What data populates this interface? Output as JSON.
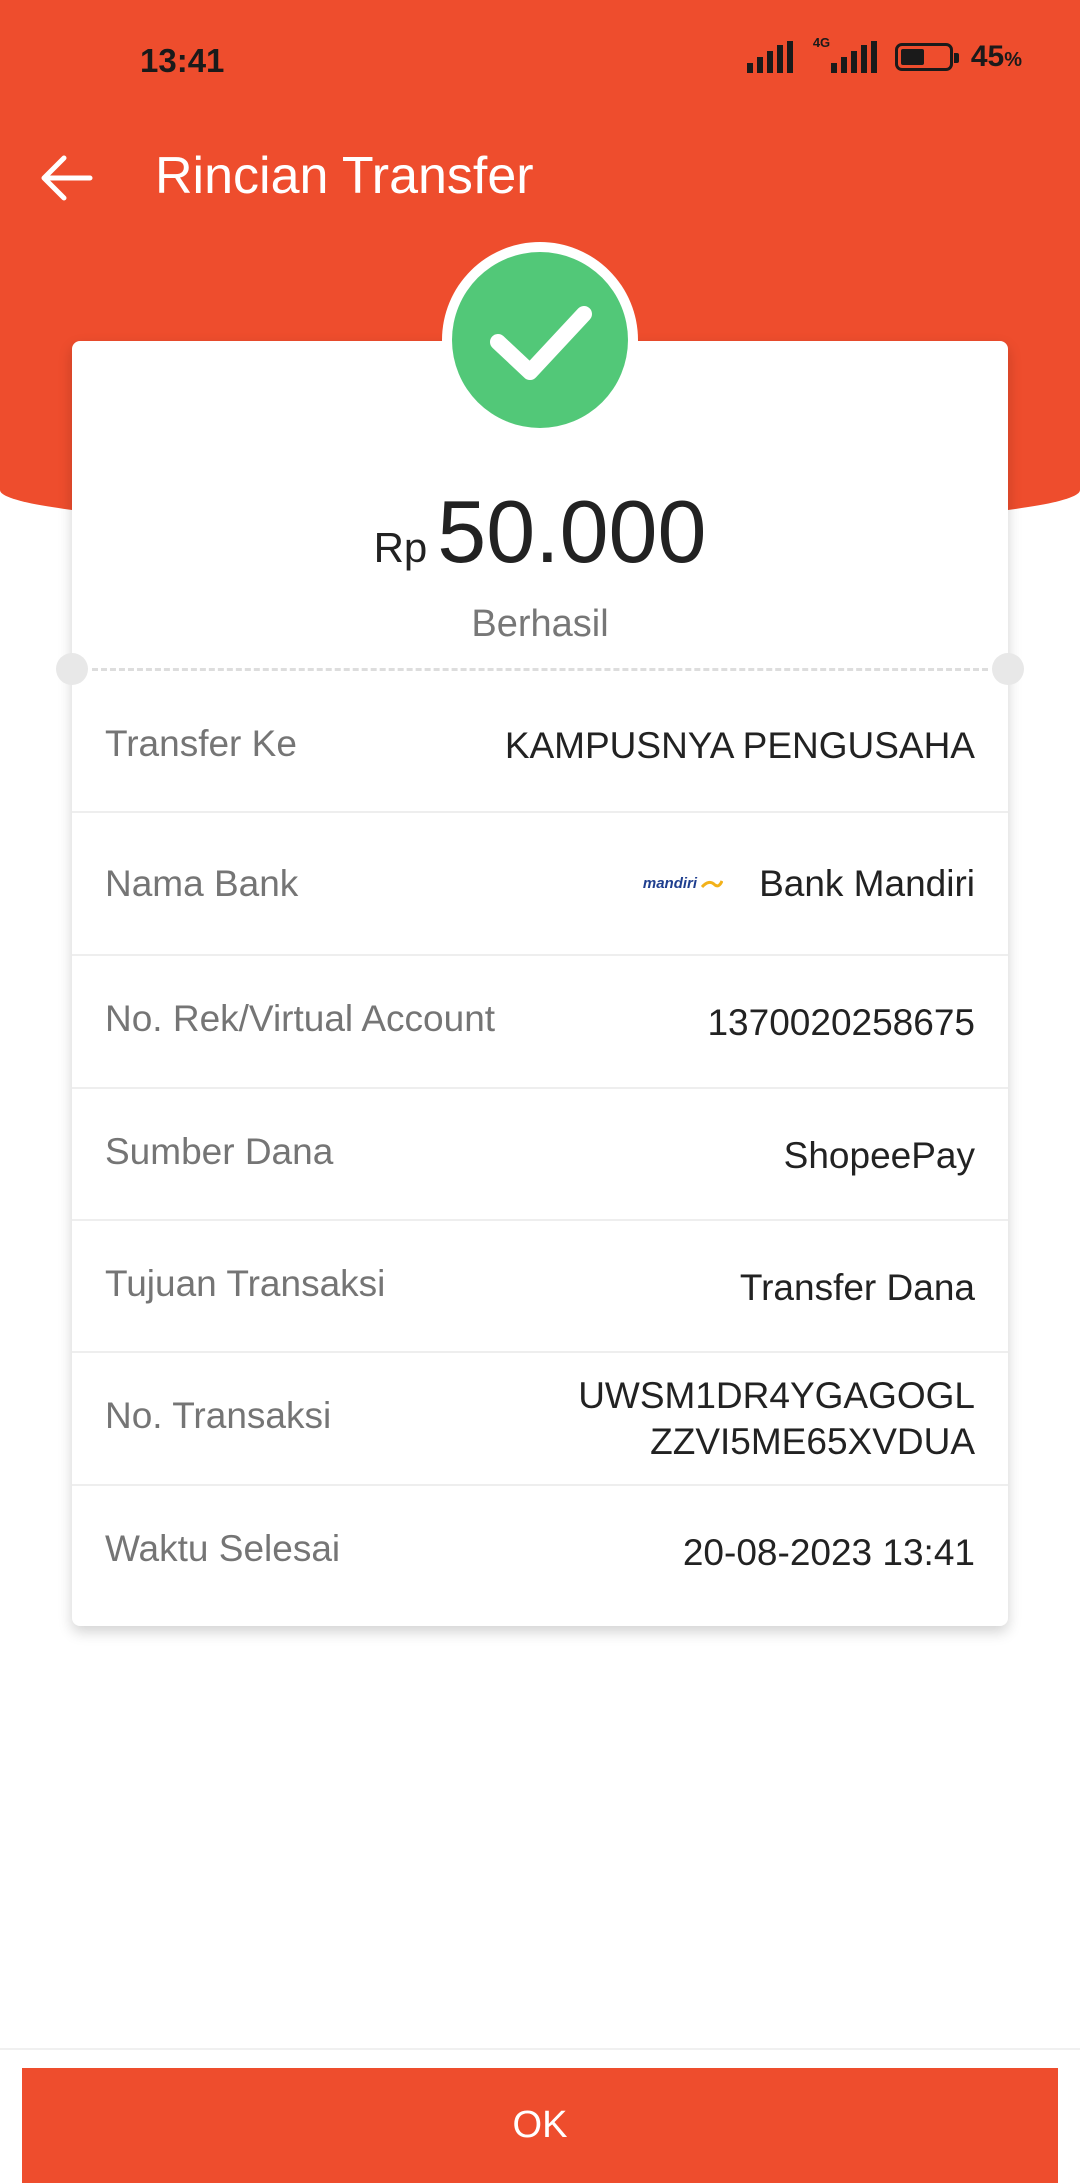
{
  "status_bar": {
    "time": "13:41",
    "network": "4G",
    "battery_percent": "45",
    "battery_unit": "%",
    "battery_level": 0.45
  },
  "header": {
    "title": "Rincian Transfer"
  },
  "receipt": {
    "currency": "Rp",
    "amount": "50.000",
    "status": "Berhasil",
    "status_color": "#52c878",
    "rows": [
      {
        "label": "Transfer Ke",
        "value": "KAMPUSNYA PENGUSAHA"
      },
      {
        "label": "Nama Bank",
        "value": "Bank Mandiri",
        "logo_text": "mandiri"
      },
      {
        "label": "No. Rek/Virtual Account",
        "value": "1370020258675"
      },
      {
        "label": "Sumber Dana",
        "value": "ShopeePay"
      },
      {
        "label": "Tujuan Transaksi",
        "value": "Transfer Dana"
      },
      {
        "label": "No. Transaksi",
        "value_line1": "UWSM1DR4YGAGOGL",
        "value_line2": "ZZVI5ME65XVDUA"
      },
      {
        "label": "Waktu Selesai",
        "value": "20-08-2023 13:41"
      }
    ]
  },
  "footer": {
    "ok_label": "OK"
  },
  "colors": {
    "brand": "#ee4d2d",
    "success": "#52c878"
  },
  "icons": {
    "back": "arrow-left-icon",
    "success": "checkmark-icon",
    "bank_logo": "mandiri-logo"
  }
}
